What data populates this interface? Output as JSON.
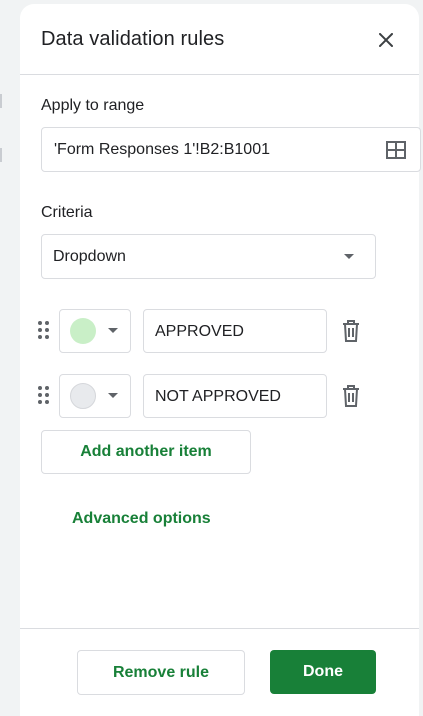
{
  "panel": {
    "title": "Data validation rules",
    "close_icon": "close-icon"
  },
  "range": {
    "label": "Apply to range",
    "value": "'Form Responses 1'!B2:B1001",
    "icon": "grid-select-icon"
  },
  "criteria": {
    "label": "Criteria",
    "value": "Dropdown"
  },
  "items": [
    {
      "value": "APPROVED",
      "color": "#c9efc7"
    },
    {
      "value": "NOT APPROVED",
      "color": "#e8eaed"
    }
  ],
  "actions": {
    "add_item": "Add another item",
    "advanced": "Advanced options",
    "remove_rule": "Remove rule",
    "done": "Done"
  },
  "colors": {
    "accent": "#188038",
    "border": "#dadce0"
  }
}
